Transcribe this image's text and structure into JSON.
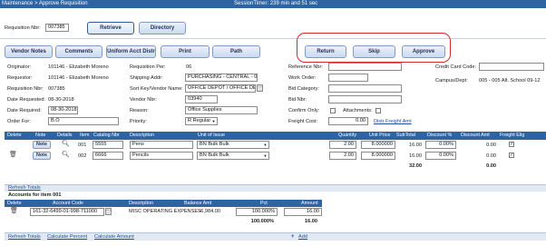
{
  "titlebar": {
    "title": "Maintenance > Approve Requisition",
    "session": "SessionTimer: 239 min and 51 sec"
  },
  "top": {
    "req_nbr_label": "Requisition Nbr:",
    "req_nbr_value": "007385",
    "retrieve_label": "Retrieve",
    "directory_label": "Directory"
  },
  "toolbar": {
    "vendor_notes": "Vendor Notes",
    "comments": "Comments",
    "uniform_acct": "Uniform Acct Distr",
    "print": "Print",
    "path": "Path",
    "return": "Return",
    "skip": "Skip",
    "approve": "Approve"
  },
  "header": {
    "originator_label": "Originator:",
    "originator_value": "101146 - Elizabeth Moreno",
    "requestor_label": "Requestor:",
    "requestor_value": "101146 - Elizabeth Moreno",
    "req_nbr_label": "Requisition Nbr:",
    "req_nbr_value": "007385",
    "date_req_label": "Date Requested:",
    "date_req_value": "08-30-2018",
    "date_required_label": "Date Required:",
    "date_required_value": "08-30-2018",
    "order_for_label": "Order For:",
    "order_for_value": "B.O",
    "req_per_label": "Requisition Per:",
    "req_per_value": "06",
    "shipping_label": "Shipping Addr:",
    "shipping_value": "PURCHASING - CENTRAL - 001",
    "sort_key_label": "Sort Key/Vendor Name:",
    "sort_key_value": "OFFICE DEPOT / OFFICE DEPOT",
    "vendor_nbr_label": "Vendor Nbr:",
    "vendor_nbr_value": "03940",
    "reason_label": "Reason:",
    "reason_value": "Office Supplies",
    "priority_label": "Priority:",
    "priority_value": "R Regular",
    "reference_label": "Reference Nbr:",
    "reference_value": "",
    "work_order_label": "Work Order:",
    "work_order_value": "",
    "bid_category_label": "Bid Category:",
    "bid_category_value": "",
    "bid_nbr_label": "Bid Nbr:",
    "bid_nbr_value": "",
    "confirm_only_label": "Confirm Only:",
    "attachments_label": "Attachments:",
    "freight_cost_label": "Freight Cost:",
    "freight_cost_value": "0.00",
    "distr_freight_label": "Distr Freight Amt",
    "credit_card_label": "Credit Card Code:",
    "credit_card_value": "",
    "campus_label": "Campus/Dept:",
    "campus_value": "005 - 005 Alt. School 09-12"
  },
  "items_grid": {
    "headers": [
      "Delete",
      "Note",
      "Details",
      "Item",
      "Catalog Nbr",
      "Description",
      "Unit of Issue",
      "Quantity",
      "Unit Price",
      "SubTotal",
      "Discount %",
      "Discount Amt",
      "Freight Elig"
    ],
    "rows": [
      {
        "note": "Note",
        "item": "001",
        "catalog": "5555",
        "description": "Pens",
        "unit": "BN Bulk Bulk",
        "quantity": "2.00",
        "unit_price": "8.000000",
        "subtotal": "16.00",
        "discount_pct": "0.00%",
        "discount_amt": "0.00",
        "freight": "✓"
      },
      {
        "note": "Note",
        "item": "002",
        "catalog": "6666",
        "description": "Pencils",
        "unit": "BN Bulk Bulk",
        "quantity": "2.00",
        "unit_price": "8.000000",
        "subtotal": "16.00",
        "discount_pct": "0.00%",
        "discount_amt": "0.00",
        "freight": "✓"
      }
    ],
    "total_subtotal": "32.00",
    "total_discount": "0.00",
    "refresh_totals": "Refresh Totals"
  },
  "accounts": {
    "title": "Accounts for item 001",
    "headers": [
      "Delete",
      "Account Code",
      "Description",
      "Balance Amt",
      "Pct",
      "Amount"
    ],
    "rows": [
      {
        "code": "161-32-6499-01-998-711000",
        "description": "MISC OPERATING EXPENSES",
        "balance": "-6,984.00",
        "pct": "100.000%",
        "amount": "16.00"
      }
    ],
    "total_pct": "100.000%",
    "total_amount": "16.00",
    "refresh_totals": "Refresh Totals",
    "calc_percent": "Calculate Percent",
    "calc_amount": "Calculate Amount",
    "add": "Add"
  },
  "colors": {
    "header_blue": "#2f64a3",
    "highlight_red": "#d92a2a"
  }
}
